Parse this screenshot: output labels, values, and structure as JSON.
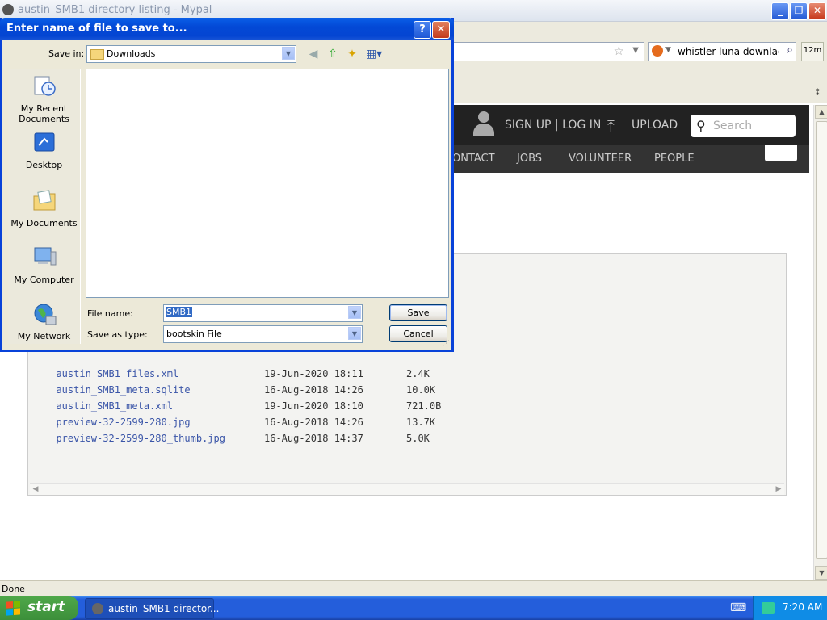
{
  "browser": {
    "title": "austin_SMB1 directory listing - Mypal",
    "search_query": "whistler luna downlaod fo",
    "badge": "12m",
    "status": "Done"
  },
  "site": {
    "signup": "SIGN UP | LOG IN",
    "upload": "UPLOAD",
    "search_placeholder": "Search",
    "nav": [
      "ONTACT",
      "JOBS",
      "VOLUNTEER",
      "PEOPLE"
    ]
  },
  "listing": {
    "rows": [
      {
        "name": "austin_SMB1_files.xml",
        "date": "19-Jun-2020 18:11",
        "size": "2.4K"
      },
      {
        "name": "austin_SMB1_meta.sqlite",
        "date": "16-Aug-2018 14:26",
        "size": "10.0K"
      },
      {
        "name": "austin_SMB1_meta.xml",
        "date": "19-Jun-2020 18:10",
        "size": "721.0B"
      },
      {
        "name": "preview-32-2599-280.jpg",
        "date": "16-Aug-2018 14:26",
        "size": "13.7K"
      },
      {
        "name": "preview-32-2599-280_thumb.jpg",
        "date": "16-Aug-2018 14:37",
        "size": "5.0K"
      }
    ]
  },
  "dialog": {
    "title": "Enter name of file to save to...",
    "save_in_label": "Save in:",
    "save_in_value": "Downloads",
    "places": [
      {
        "label1": "My Recent",
        "label2": "Documents"
      },
      {
        "label1": "Desktop",
        "label2": ""
      },
      {
        "label1": "My Documents",
        "label2": ""
      },
      {
        "label1": "My Computer",
        "label2": ""
      },
      {
        "label1": "My Network",
        "label2": ""
      }
    ],
    "file_name_label": "File name:",
    "file_name_value": "SMB1",
    "save_type_label": "Save as type:",
    "save_type_value": "bootskin File",
    "save_button": "Save",
    "cancel_button": "Cancel"
  },
  "taskbar": {
    "start": "start",
    "task": "austin_SMB1 director...",
    "time": "7:20 AM"
  }
}
